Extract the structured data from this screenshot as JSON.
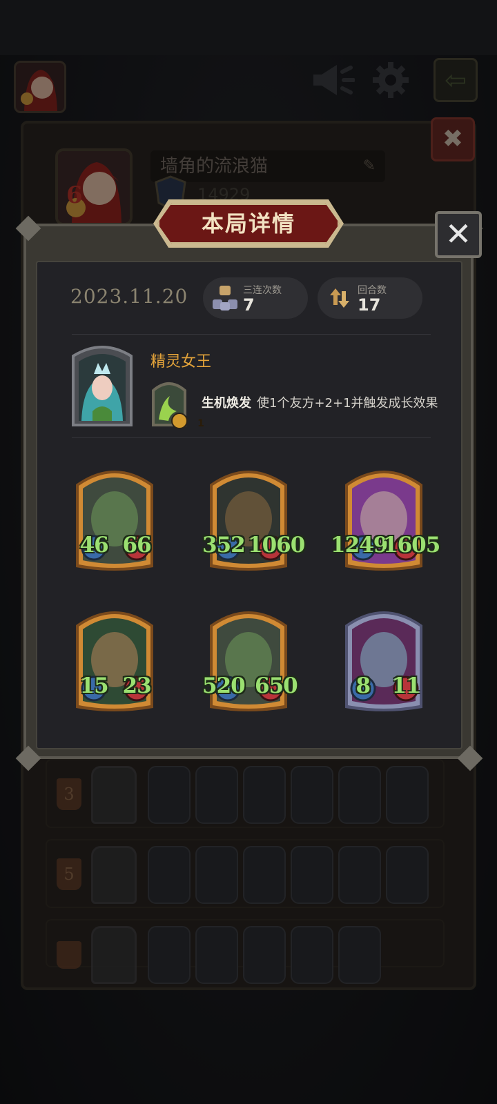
{
  "profile": {
    "name": "墙角的流浪猫",
    "score": "14929",
    "level_badge": "6"
  },
  "modal": {
    "title": "本局详情",
    "date": "2023.11.20",
    "stats": [
      {
        "label": "三连次数",
        "value": "7",
        "icon": "triple-merge-icon"
      },
      {
        "label": "回合数",
        "value": "17",
        "icon": "rounds-cycle-icon"
      }
    ],
    "hero": {
      "name": "精灵女王",
      "skill_cost": "1",
      "skill_name": "生机焕发",
      "skill_desc": "使1个友方+2+1并触发成长效果"
    },
    "cards": [
      {
        "attack": "46",
        "health": "66",
        "frame": "gold",
        "art": "carnivorous-plant"
      },
      {
        "attack": "352",
        "health": "1060",
        "frame": "gold",
        "art": "treant"
      },
      {
        "attack": "1249",
        "health": "1605",
        "frame": "gold",
        "art": "mushroom-spider"
      },
      {
        "attack": "15",
        "health": "23",
        "frame": "gold",
        "art": "flower-dryad"
      },
      {
        "attack": "520",
        "health": "650",
        "frame": "gold",
        "art": "carnivorous-plant"
      },
      {
        "attack": "8",
        "health": "11",
        "frame": "silver",
        "art": "elf-sorceress"
      }
    ]
  },
  "history": [
    {
      "rank": "3"
    },
    {
      "rank": "5"
    },
    {
      "rank": ""
    }
  ],
  "colors": {
    "accent_gold": "#e3a33a",
    "stat_green": "#9be071",
    "banner_red": "#6b1715"
  }
}
